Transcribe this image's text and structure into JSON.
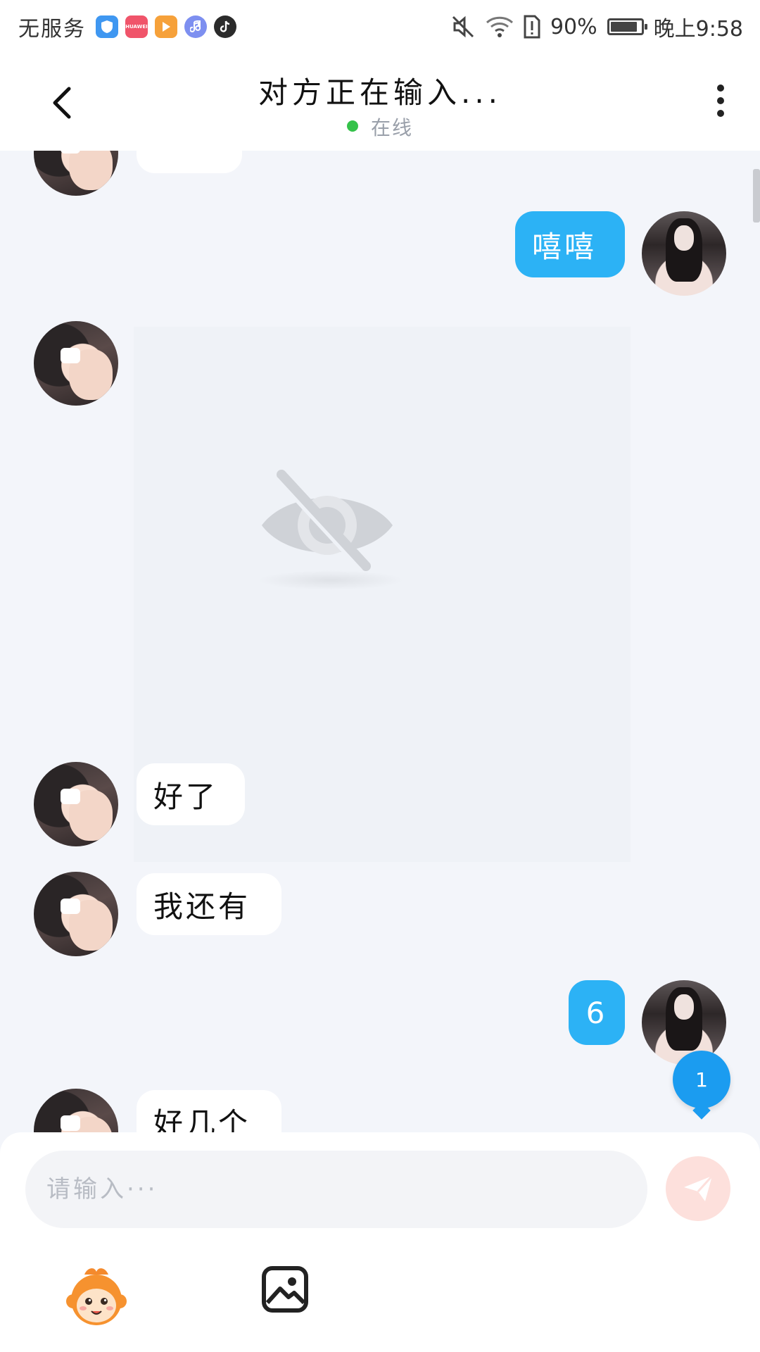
{
  "status_bar": {
    "carrier": "无服务",
    "apps": [
      {
        "name": "shield-app-icon",
        "color": "#3f97f1"
      },
      {
        "name": "huawei-store-icon",
        "color": "#f0546a",
        "label": "HUAWEI"
      },
      {
        "name": "video-app-icon",
        "color": "#f6a13a"
      },
      {
        "name": "music-app-icon",
        "color": "#7d8ff0"
      },
      {
        "name": "tiktok-icon",
        "color": "#2b2b2b"
      }
    ],
    "battery_percent": "90%",
    "battery_level": 0.9,
    "time": "晚上9:58"
  },
  "header": {
    "title": "对方正在输入...",
    "status": "在线"
  },
  "messages": [
    {
      "from": "other",
      "type": "text",
      "text": ""
    },
    {
      "from": "me",
      "type": "text",
      "text": "嘻嘻"
    },
    {
      "from": "other",
      "type": "image-hidden"
    },
    {
      "from": "other",
      "type": "text",
      "text": "好了"
    },
    {
      "from": "other",
      "type": "text",
      "text": "我还有"
    },
    {
      "from": "me",
      "type": "text",
      "text": "6"
    },
    {
      "from": "other",
      "type": "text",
      "text": "好几个"
    }
  ],
  "unread_count": "1",
  "composer": {
    "placeholder": "请输入···"
  },
  "colors": {
    "my_bubble": "#2cb2f5",
    "online": "#35c24a",
    "badge": "#1b9cf0",
    "send_disabled": "#fde0dc"
  }
}
